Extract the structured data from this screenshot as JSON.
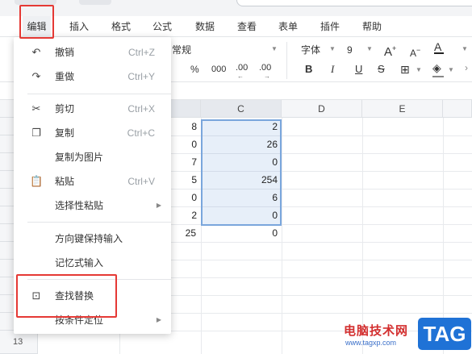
{
  "menubar": {
    "items": [
      "编辑",
      "插入",
      "格式",
      "公式",
      "数据",
      "查看",
      "表单",
      "插件",
      "帮助"
    ]
  },
  "toolbar": {
    "number_format": "常规",
    "percent": "%",
    "thousands": "000",
    "decimal_decrease": ".00",
    "decimal_increase": ".00",
    "font_name": "字体",
    "font_size": "9",
    "font_grow": "A",
    "font_shrink": "A",
    "font_color": "A",
    "bold": "B",
    "italic": "I",
    "underline": "U",
    "strike": "S"
  },
  "grid": {
    "columns": [
      "C",
      "D",
      "E"
    ],
    "col_b_values": [
      "8",
      "0",
      "7",
      "5",
      "0",
      "2",
      "25"
    ],
    "col_c_values": [
      "2",
      "26",
      "0",
      "254",
      "6",
      "0",
      "0"
    ],
    "last_row_number": "13"
  },
  "edit_menu": {
    "items": [
      {
        "label": "撤销",
        "shortcut": "Ctrl+Z"
      },
      {
        "label": "重做",
        "shortcut": "Ctrl+Y"
      },
      {
        "label": "剪切",
        "shortcut": "Ctrl+X"
      },
      {
        "label": "复制",
        "shortcut": "Ctrl+C"
      },
      {
        "label": "复制为图片",
        "shortcut": ""
      },
      {
        "label": "粘贴",
        "shortcut": "Ctrl+V"
      },
      {
        "label": "选择性粘贴",
        "shortcut": ""
      },
      {
        "label": "方向键保持输入",
        "shortcut": ""
      },
      {
        "label": "记忆式输入",
        "shortcut": ""
      },
      {
        "label": "查找替换",
        "shortcut": ""
      },
      {
        "label": "按条件定位",
        "shortcut": ""
      }
    ]
  },
  "watermark": {
    "site_name": "电脑技术网",
    "url": "www.tagxp.com",
    "tag": "TAG"
  },
  "colors": {
    "highlight_red": "#e53935",
    "selection_border": "#7aa6dc",
    "watermark_blue": "#1f72d6"
  }
}
